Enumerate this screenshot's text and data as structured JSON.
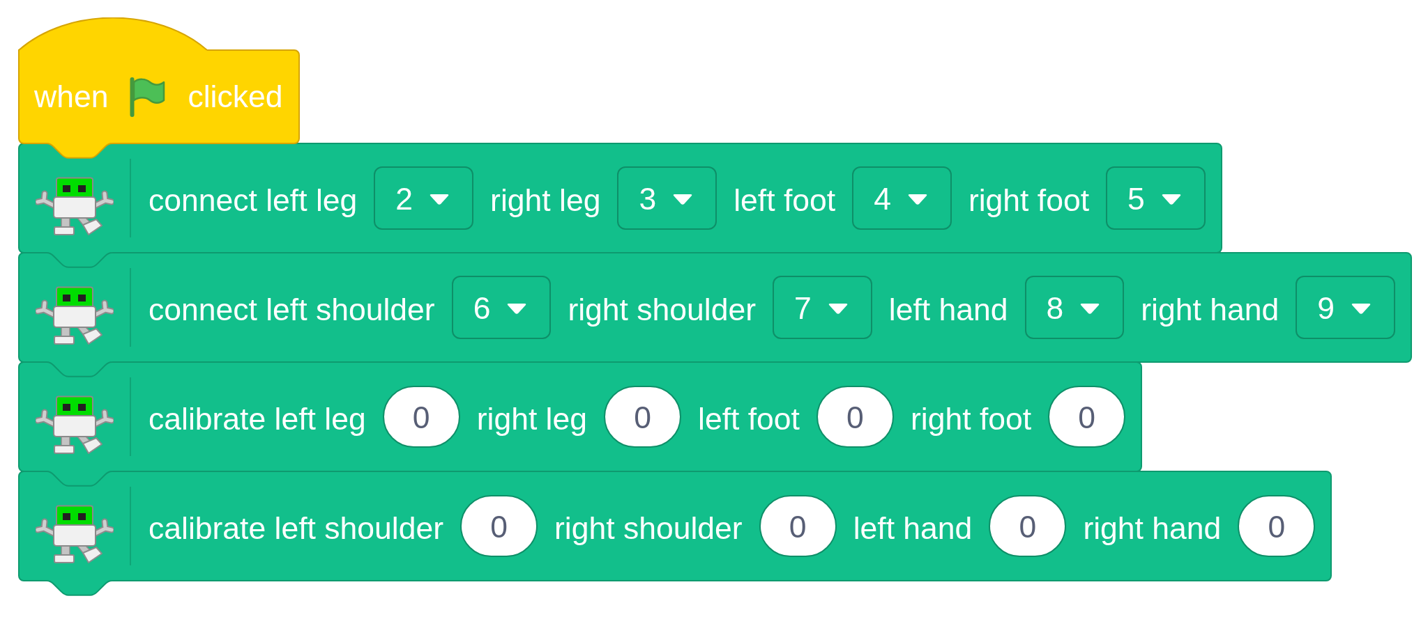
{
  "hat_block": {
    "parts": [
      {
        "kind": "label",
        "text": "when"
      },
      {
        "kind": "icon"
      },
      {
        "kind": "label",
        "text": "clicked"
      }
    ]
  },
  "blocks": [
    {
      "parts": [
        {
          "kind": "label",
          "text": "connect left leg"
        },
        {
          "kind": "dropdown",
          "value": "2"
        },
        {
          "kind": "label",
          "text": "right leg"
        },
        {
          "kind": "dropdown",
          "value": "3"
        },
        {
          "kind": "label",
          "text": "left foot"
        },
        {
          "kind": "dropdown",
          "value": "4"
        },
        {
          "kind": "label",
          "text": "right foot"
        },
        {
          "kind": "dropdown",
          "value": "5"
        }
      ]
    },
    {
      "parts": [
        {
          "kind": "label",
          "text": "connect left shoulder"
        },
        {
          "kind": "dropdown",
          "value": "6"
        },
        {
          "kind": "label",
          "text": "right shoulder"
        },
        {
          "kind": "dropdown",
          "value": "7"
        },
        {
          "kind": "label",
          "text": "left hand"
        },
        {
          "kind": "dropdown",
          "value": "8"
        },
        {
          "kind": "label",
          "text": "right hand"
        },
        {
          "kind": "dropdown",
          "value": "9"
        }
      ]
    },
    {
      "parts": [
        {
          "kind": "label",
          "text": "calibrate left leg"
        },
        {
          "kind": "number",
          "value": "0"
        },
        {
          "kind": "label",
          "text": "right leg"
        },
        {
          "kind": "number",
          "value": "0"
        },
        {
          "kind": "label",
          "text": "left foot"
        },
        {
          "kind": "number",
          "value": "0"
        },
        {
          "kind": "label",
          "text": "right foot"
        },
        {
          "kind": "number",
          "value": "0"
        }
      ]
    },
    {
      "parts": [
        {
          "kind": "label",
          "text": "calibrate left shoulder"
        },
        {
          "kind": "number",
          "value": "0"
        },
        {
          "kind": "label",
          "text": "right shoulder"
        },
        {
          "kind": "number",
          "value": "0"
        },
        {
          "kind": "label",
          "text": "left hand"
        },
        {
          "kind": "number",
          "value": "0"
        },
        {
          "kind": "label",
          "text": "right hand"
        },
        {
          "kind": "number",
          "value": "0"
        }
      ]
    }
  ]
}
